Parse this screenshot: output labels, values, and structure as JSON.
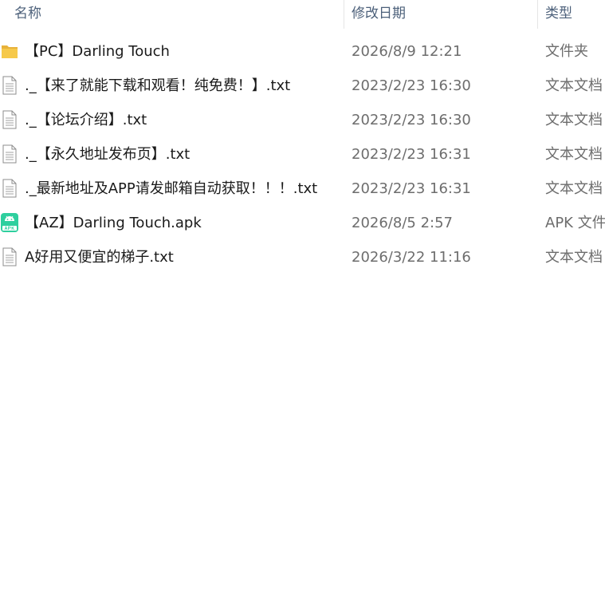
{
  "columns": {
    "name": "名称",
    "date": "修改日期",
    "type": "类型"
  },
  "files": [
    {
      "name": "【PC】Darling Touch",
      "date": "2026/8/9 12:21",
      "type": "文件夹",
      "icon": "folder-icon"
    },
    {
      "name": "._【来了就能下载和观看！纯免费！】.txt",
      "date": "2023/2/23 16:30",
      "type": "文本文档",
      "icon": "text-file-icon"
    },
    {
      "name": "._【论坛介绍】.txt",
      "date": "2023/2/23 16:30",
      "type": "文本文档",
      "icon": "text-file-icon"
    },
    {
      "name": "._【永久地址发布页】.txt",
      "date": "2023/2/23 16:31",
      "type": "文本文档",
      "icon": "text-file-icon"
    },
    {
      "name": "._最新地址及APP请发邮箱自动获取！！！.txt",
      "date": "2023/2/23 16:31",
      "type": "文本文档",
      "icon": "text-file-icon"
    },
    {
      "name": "【AZ】Darling Touch.apk",
      "date": "2026/8/5 2:57",
      "type": "APK 文件",
      "icon": "apk-icon"
    },
    {
      "name": "A好用又便宜的梯子.txt",
      "date": "2026/3/22 11:16",
      "type": "文本文档",
      "icon": "text-file-icon"
    }
  ],
  "colors": {
    "header_text": "#4c607a",
    "name_text": "#1a1a1a",
    "meta_text": "#6d6d6d",
    "folder": "#f6c94a",
    "apk": "#2ecf9e"
  }
}
